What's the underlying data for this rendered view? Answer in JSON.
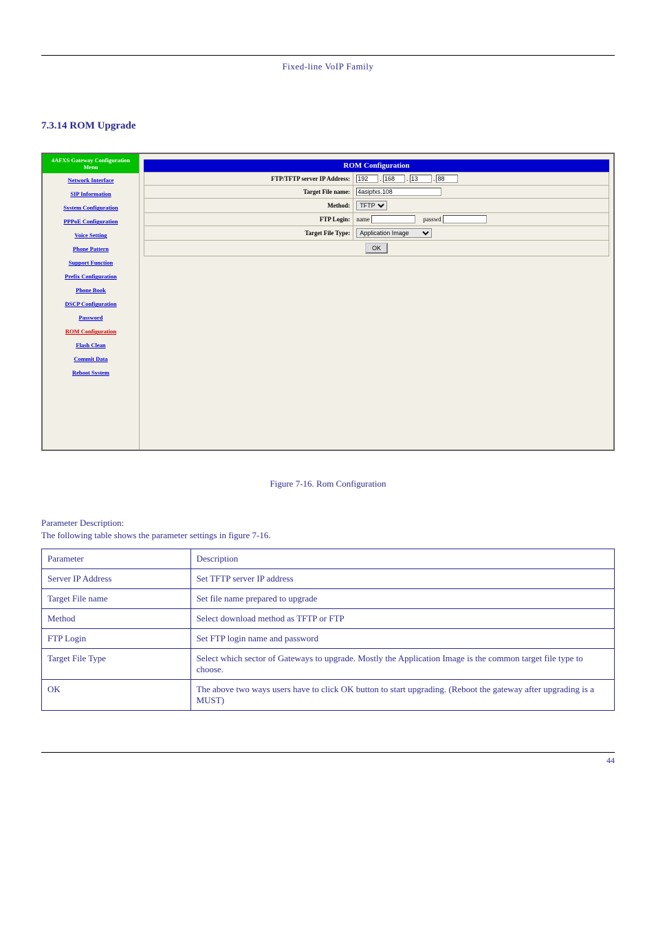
{
  "doc": {
    "header_title": "Fixed-line VoIP Family",
    "section_heading": "7.3.14  ROM Upgrade",
    "figure_caption": "Figure 7-16. Rom Configuration",
    "desc_line1": "Parameter Description:",
    "desc_line2": "The following table shows the parameter settings in figure 7-16.",
    "footer_page": "44"
  },
  "screenshot": {
    "sidebar_header": "4AFXS Gateway Configuration Menu",
    "menu": [
      "Network Interface",
      "SIP Information",
      "System Configuration",
      "PPPoE Configuration",
      "Voice Setting",
      "Phone Pattern",
      "Support Function",
      "Prefix Configuration",
      "Phone Book",
      "DSCP Configuration",
      "Password",
      "ROM Configuration",
      "Flash Clean",
      "Commit Data",
      "Reboot System"
    ],
    "panel_title": "ROM Configuration",
    "rows": {
      "ip_label": "FTP/TFTP server IP Address:",
      "ip": [
        "192",
        "168",
        "13",
        "88"
      ],
      "file_label": "Target File name:",
      "file_value": "4asipfxs.108",
      "method_label": "Method:",
      "method_value": "TFTP",
      "login_label": "FTP Login:",
      "login_name_lbl": "name",
      "login_pass_lbl": "passwd",
      "type_label": "Target File Type:",
      "type_value": "Application Image",
      "ok": "OK"
    }
  },
  "params": [
    {
      "name": "Parameter",
      "desc": "Description"
    },
    {
      "name": "Server IP Address",
      "desc": "Set TFTP server IP address"
    },
    {
      "name": "Target File name",
      "desc": "Set file name prepared to upgrade"
    },
    {
      "name": "Method",
      "desc": "Select download method as TFTP or FTP"
    },
    {
      "name": "FTP Login",
      "desc": "Set FTP login name and password"
    },
    {
      "name": "Target File Type",
      "desc": "Select which sector of Gateways to upgrade. Mostly the Application Image is the common target file type to choose."
    },
    {
      "name": "OK",
      "desc": "The above two ways users have to click OK button to start upgrading. (Reboot the gateway after upgrading is a MUST)"
    }
  ]
}
